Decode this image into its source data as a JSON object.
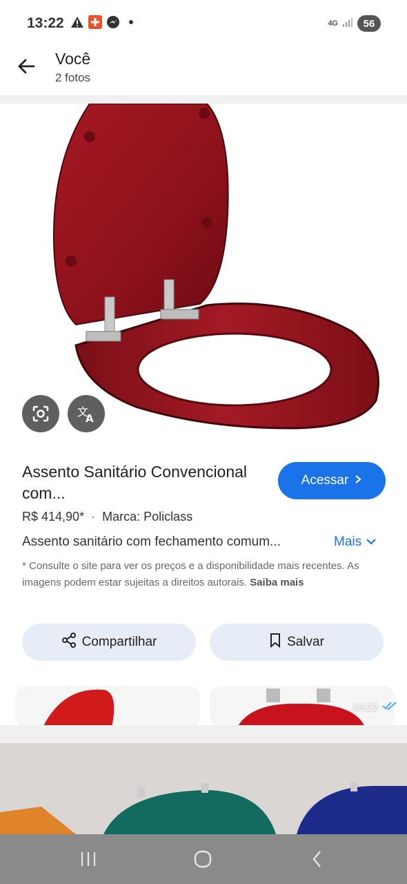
{
  "status_bar": {
    "time": "13:22",
    "icons": [
      "warning-icon",
      "notification-app-icon",
      "messenger-icon",
      "dot-icon"
    ],
    "network": "4G",
    "battery": "56"
  },
  "app_bar": {
    "title": "Você",
    "subtitle": "2 fotos"
  },
  "product": {
    "title": "Assento Sanitário Convencional com...",
    "action_label": "Acessar",
    "price": "R$ 414,90*",
    "brand": "Marca: Policlass",
    "description": "Assento sanitário com fechamento comum...",
    "more_label": "Mais",
    "disclaimer": "* Consulte o site para ver os preços e a disponibilidade mais recentes. As imagens podem estar sujeitas a direitos autorais.",
    "learn_more": "Saiba mais",
    "share_label": "Compartilhar",
    "save_label": "Salvar"
  },
  "image_actions": [
    "lens-search-icon",
    "translate-icon"
  ],
  "message": {
    "time": "13:22",
    "read_icon": "double-check-icon"
  },
  "colors": {
    "accent": "#1a73e8",
    "pill_bg": "#e7edf7",
    "seat_red": "#9b1520"
  }
}
